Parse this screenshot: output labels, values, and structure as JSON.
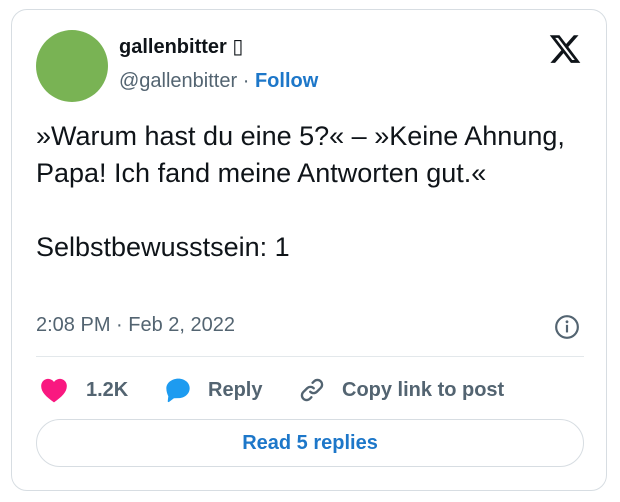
{
  "author": {
    "name": "gallenbitter",
    "name_suffix": "▯",
    "handle": "@gallenbitter",
    "separator": "·",
    "follow_label": "Follow",
    "avatar_color": "#79b354"
  },
  "tweet": {
    "lines": [
      "»Warum hast du eine 5?« – »Keine Ahnung, Papa! Ich fand meine Antworten gut.«",
      "Selbstbewusstsein: 1"
    ],
    "timestamp": "2:08 PM · Feb 2, 2022"
  },
  "actions": {
    "like_count": "1.2K",
    "reply_label": "Reply",
    "copy_label": "Copy link to post",
    "read_replies_label": "Read 5 replies"
  },
  "colors": {
    "like": "#f91880",
    "reply": "#1d9bf0",
    "link": "#1d77c9",
    "muted": "#536471",
    "text": "#0f1419"
  },
  "icons": [
    "x-logo-icon",
    "info-icon",
    "heart-icon",
    "reply-bubble-icon",
    "link-icon"
  ]
}
